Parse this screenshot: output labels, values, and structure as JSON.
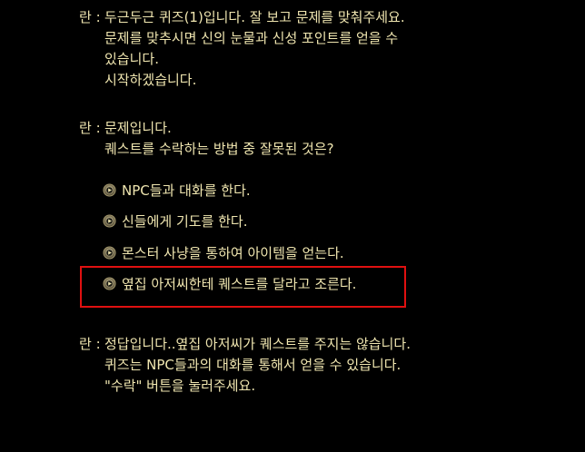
{
  "intro": {
    "speaker": "란 :",
    "lines": [
      "두근두근 퀴즈(1)입니다. 잘 보고 문제를 맞춰주세요.",
      "문제를 맞추시면 신의 눈물과 신성 포인트를 얻을 수",
      "있습니다.",
      "시작하겠습니다."
    ]
  },
  "question": {
    "speaker": "란 :",
    "lines": [
      "문제입니다.",
      "퀘스트를 수락하는 방법 중 잘못된 것은?"
    ]
  },
  "options": [
    {
      "label": "NPC들과 대화를 한다.",
      "icon": "bullet-orb-icon"
    },
    {
      "label": "신들에게 기도를 한다.",
      "icon": "bullet-orb-icon"
    },
    {
      "label": "몬스터 사냥을 통하여 아이템을 얻는다.",
      "icon": "bullet-orb-icon"
    },
    {
      "label": "옆집 아저씨한테 퀘스트를 달라고 조른다.",
      "icon": "bullet-orb-icon",
      "highlighted": true
    }
  ],
  "answer": {
    "speaker": "란 :",
    "lines": [
      "정답입니다..옆집 아저씨가 퀘스트를 주지는 않습니다.",
      "퀴즈는 NPC들과의 대화를 통해서 얻을 수 있습니다.",
      "\"수락\" 버튼을 눌러주세요."
    ]
  },
  "colors": {
    "background": "#000000",
    "text": "#f0e6b0",
    "highlight_border": "#e01010"
  }
}
